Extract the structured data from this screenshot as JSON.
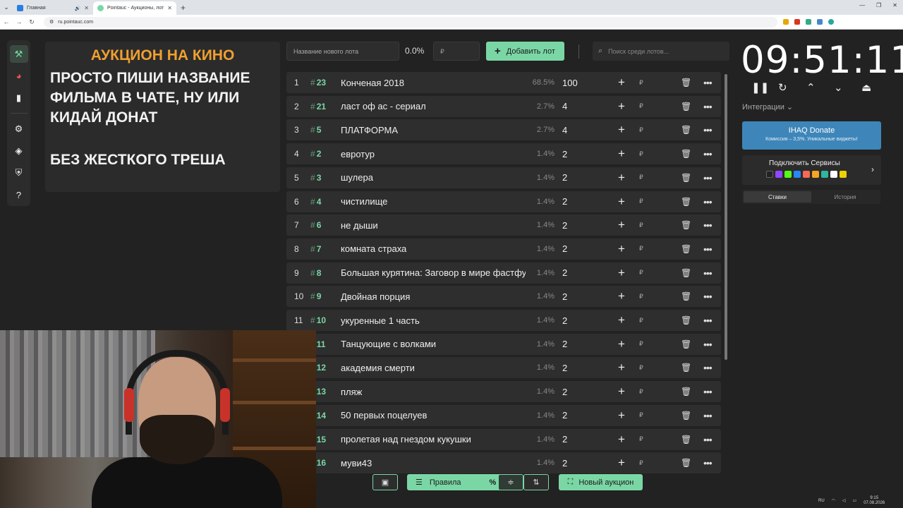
{
  "browser": {
    "tabs": [
      {
        "title": "Главная",
        "active": false
      },
      {
        "title": "Pointauc - Аукционы, лотерея",
        "active": true
      }
    ],
    "url": "ru.pointauc.com"
  },
  "overlay": {
    "heading": "АУКЦИОН НА КИНО",
    "line1": "ПРОСТО ПИШИ НАЗВАНИЕ",
    "line2": "ФИЛЬМА В ЧАТЕ, НУ ИЛИ",
    "line3": "КИДАЙ ДОНАТ",
    "line4": "БЕЗ ЖЕСТКОГО ТРЕША"
  },
  "controls": {
    "lot_name_placeholder": "Название нового лота",
    "percent": "0.0%",
    "currency_placeholder": "₽",
    "add_lot": "Добавить лот",
    "search_placeholder": "Поиск среди лотов..."
  },
  "lots": [
    {
      "idx": "1",
      "id": "23",
      "name": "Конченая 2018",
      "pct": "68.5%",
      "amount": "100"
    },
    {
      "idx": "2",
      "id": "21",
      "name": "ласт оф ас - сериал",
      "pct": "2.7%",
      "amount": "4"
    },
    {
      "idx": "3",
      "id": "5",
      "name": "ПЛАТФОРМА",
      "pct": "2.7%",
      "amount": "4"
    },
    {
      "idx": "4",
      "id": "2",
      "name": " евротур",
      "pct": "1.4%",
      "amount": "2"
    },
    {
      "idx": "5",
      "id": "3",
      "name": "шулера",
      "pct": "1.4%",
      "amount": "2"
    },
    {
      "idx": "6",
      "id": "4",
      "name": "чистилище",
      "pct": "1.4%",
      "amount": "2"
    },
    {
      "idx": "7",
      "id": "6",
      "name": "не дыши",
      "pct": "1.4%",
      "amount": "2"
    },
    {
      "idx": "8",
      "id": "7",
      "name": "комната страха",
      "pct": "1.4%",
      "amount": "2"
    },
    {
      "idx": "9",
      "id": "8",
      "name": "Большая курятина: Заговор в мире фастфуда",
      "pct": "1.4%",
      "amount": "2"
    },
    {
      "idx": "10",
      "id": "9",
      "name": "Двойная порция",
      "pct": "1.4%",
      "amount": "2"
    },
    {
      "idx": "11",
      "id": "10",
      "name": " укуренные 1 часть",
      "pct": "1.4%",
      "amount": "2"
    },
    {
      "idx": "",
      "id": "11",
      "name": " Танцующие с волками",
      "pct": "1.4%",
      "amount": "2"
    },
    {
      "idx": "",
      "id": "12",
      "name": "академия смерти",
      "pct": "1.4%",
      "amount": "2"
    },
    {
      "idx": "",
      "id": "13",
      "name": " пляж",
      "pct": "1.4%",
      "amount": "2"
    },
    {
      "idx": "",
      "id": "14",
      "name": "50 первых поцелуев",
      "pct": "1.4%",
      "amount": "2"
    },
    {
      "idx": "",
      "id": "15",
      "name": "пролетая над гнездом кукушки",
      "pct": "1.4%",
      "amount": "2"
    },
    {
      "idx": "",
      "id": "16",
      "name": "муви43",
      "pct": "1.4%",
      "amount": "2"
    }
  ],
  "row_currency": "₽",
  "bottom": {
    "rules": "Правила",
    "percent_icon": "%",
    "new_auction": "Новый аукцион"
  },
  "timer": "09:51:11",
  "right": {
    "integrations": "Интеграции",
    "donate_title": "IHAQ Donate",
    "donate_sub": "Комиссия – 3,5%. Уникальные виджеты!",
    "connect": "Подключить Сервисы",
    "tab_bets": "Ставки",
    "tab_history": "История"
  },
  "tray": {
    "lang": "RU",
    "time": "9:15",
    "date": "07.08.2026"
  }
}
